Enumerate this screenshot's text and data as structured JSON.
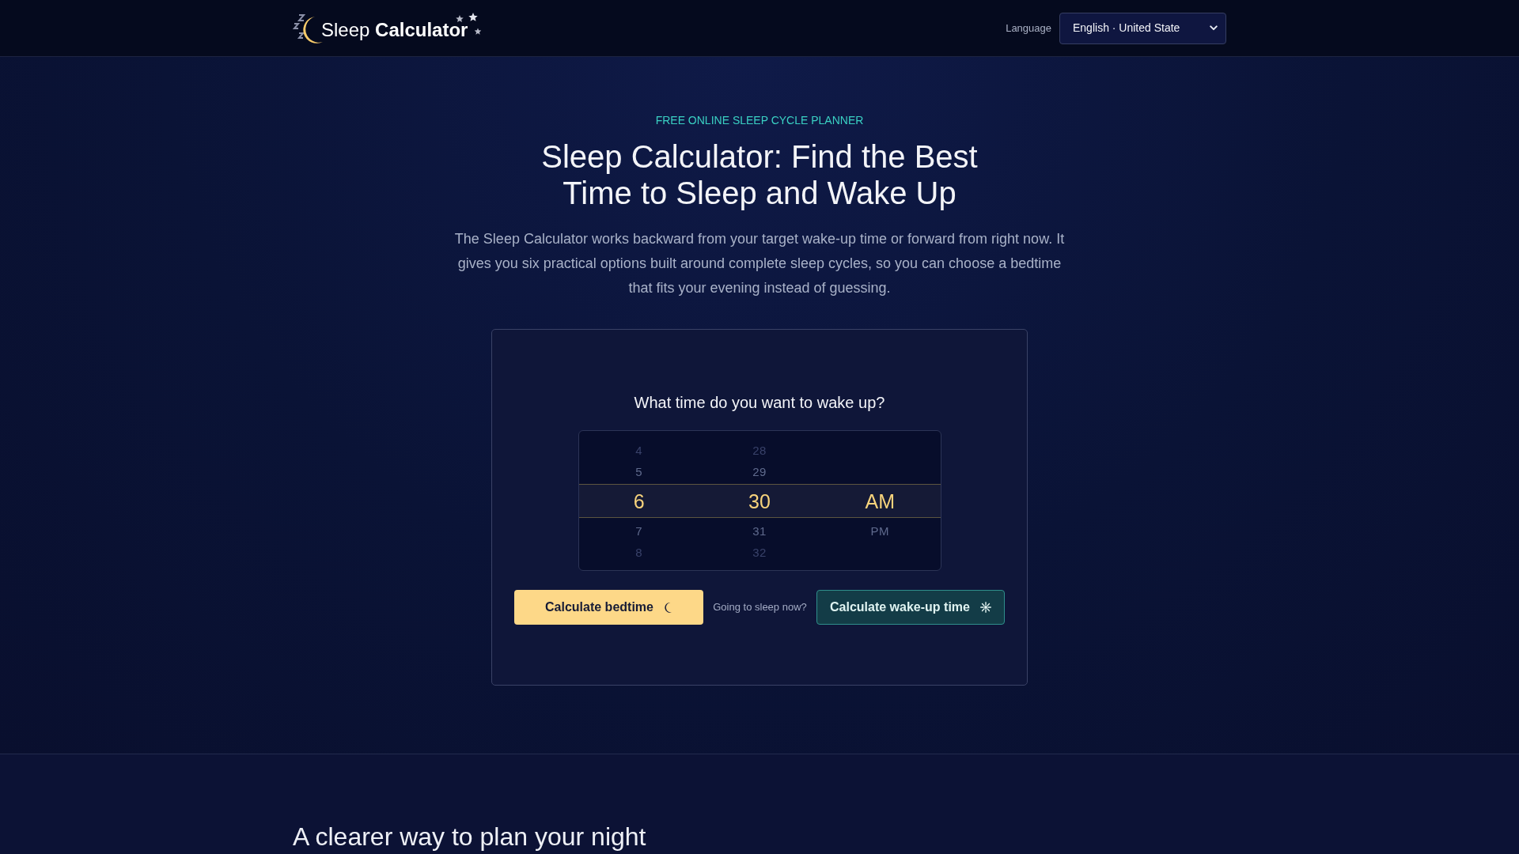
{
  "header": {
    "logo_text": "Sleep **Calculator**",
    "language": {
      "label": "Language",
      "value": "English · United State"
    }
  },
  "hero": {
    "eyebrow": "FREE ONLINE SLEEP CYCLE PLANNER",
    "title": "Sleep Calculator: Find the Best Time to Sleep and Wake Up",
    "description": "The Sleep Calculator works backward from your target wake-up time or forward from right now. It gives you six practical options built around complete sleep cycles, so you can choose a bedtime that fits your evening instead of guessing."
  },
  "calculator": {
    "question": "What time do you want to wake up?",
    "picker": {
      "columns": [
        {
          "items": [
            {
              "label": "4",
              "selected": false
            },
            {
              "label": "5",
              "selected": false
            },
            {
              "label": "6",
              "selected": true
            },
            {
              "label": "7",
              "selected": false
            },
            {
              "label": "8",
              "selected": false
            }
          ]
        },
        {
          "items": [
            {
              "label": "28",
              "selected": false
            },
            {
              "label": "29",
              "selected": false
            },
            {
              "label": "30",
              "selected": true
            },
            {
              "label": "31",
              "selected": false
            },
            {
              "label": "32",
              "selected": false
            }
          ]
        },
        {
          "items": [
            {
              "label": "AM",
              "selected": true
            },
            {
              "label": "PM",
              "selected": false
            }
          ]
        }
      ]
    },
    "actions": [
      {
        "kind": "bedtime",
        "label": "Calculate bedtime"
      },
      {
        "kind": "note",
        "label": "Going to sleep now?"
      },
      {
        "kind": "wakeup",
        "label": "Calculate wake-up time"
      }
    ]
  },
  "next_section": {
    "heading": "A clearer way to plan your night"
  }
}
